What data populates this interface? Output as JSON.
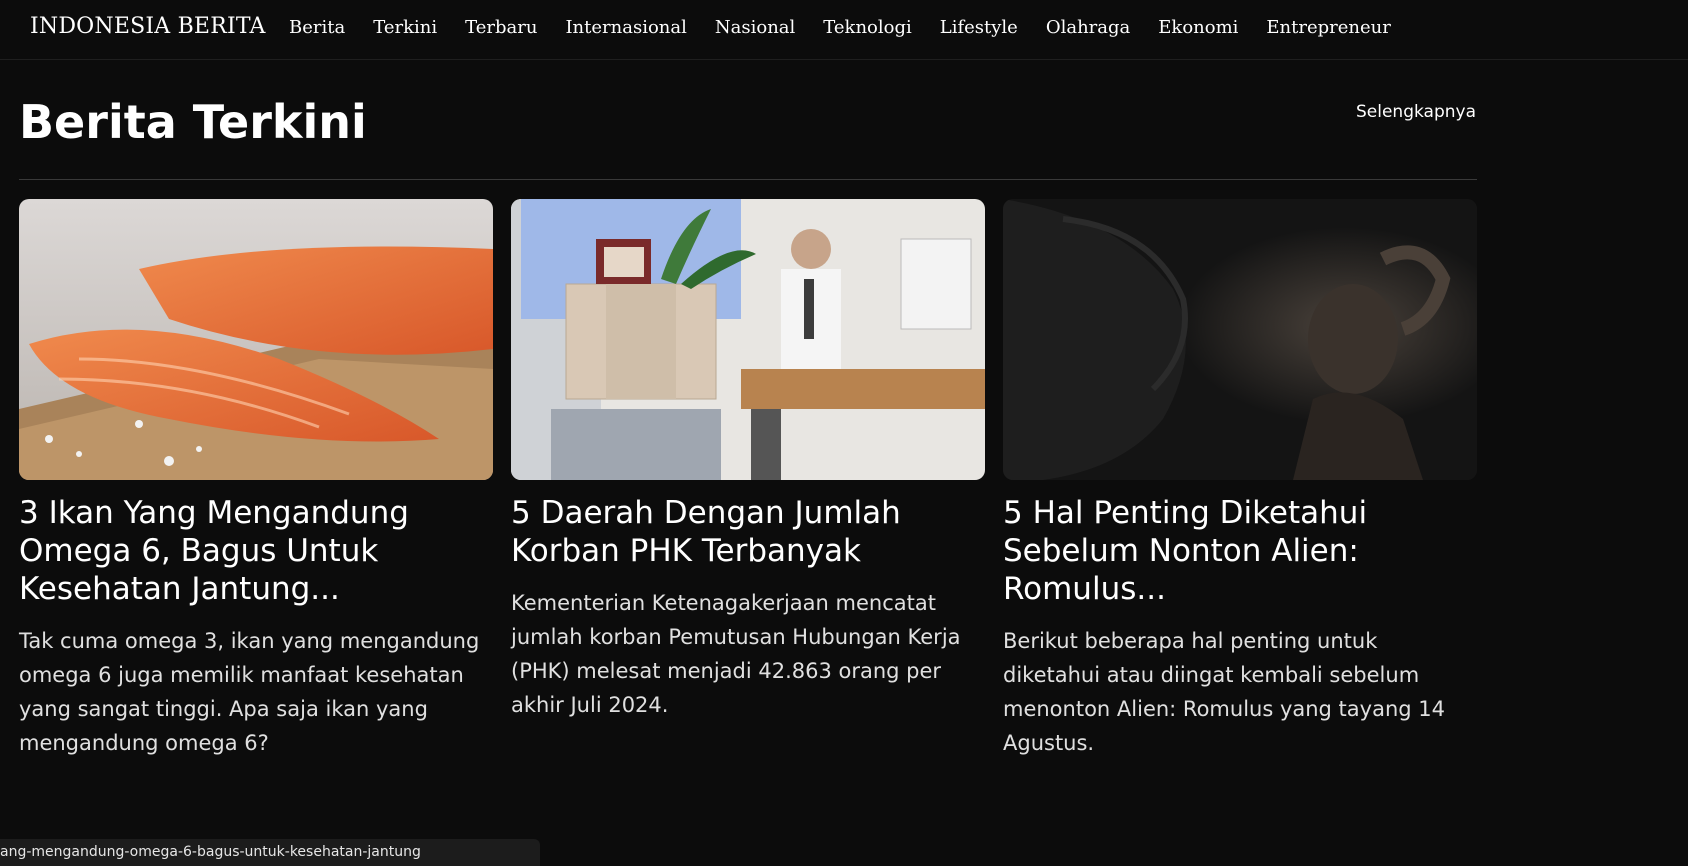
{
  "site": {
    "brand": "INDONESIA BERITA"
  },
  "nav": {
    "items": [
      {
        "label": "Berita"
      },
      {
        "label": "Terkini"
      },
      {
        "label": "Terbaru"
      },
      {
        "label": "Internasional"
      },
      {
        "label": "Nasional"
      },
      {
        "label": "Teknologi"
      },
      {
        "label": "Lifestyle"
      },
      {
        "label": "Olahraga"
      },
      {
        "label": "Ekonomi"
      },
      {
        "label": "Entrepreneur"
      }
    ]
  },
  "section": {
    "title": "Berita Terkini",
    "more_label": "Selengkapnya"
  },
  "cards": [
    {
      "image": "salmon-fillet-photo",
      "title": "3 Ikan Yang Mengandung Omega 6, Bagus Untuk Kesehatan Jantung...",
      "description": "Tak cuma omega 3, ikan yang mengandung omega 6 juga memilik manfaat kesehatan yang sangat tinggi. Apa saja ikan yang mengandung omega 6?"
    },
    {
      "image": "office-worker-box-photo",
      "title": "5 Daerah Dengan Jumlah Korban PHK Terbanyak",
      "description": "Kementerian Ketenagakerjaan mencatat jumlah korban Pemutusan Hubungan Kerja (PHK) melesat menjadi 42.863 orang per akhir Juli 2024."
    },
    {
      "image": "alien-romulus-photo",
      "title": "5 Hal Penting Diketahui Sebelum Nonton Alien: Romulus...",
      "description": "Berikut beberapa hal penting untuk diketahui atau diingat kembali sebelum menonton Alien: Romulus yang tayang 14 Agustus."
    }
  ],
  "status_bar": {
    "url": "ang-mengandung-omega-6-bagus-untuk-kesehatan-jantung"
  },
  "colors": {
    "background": "#0c0c0c",
    "text": "#ffffff",
    "divider": "#3a3a3a"
  }
}
